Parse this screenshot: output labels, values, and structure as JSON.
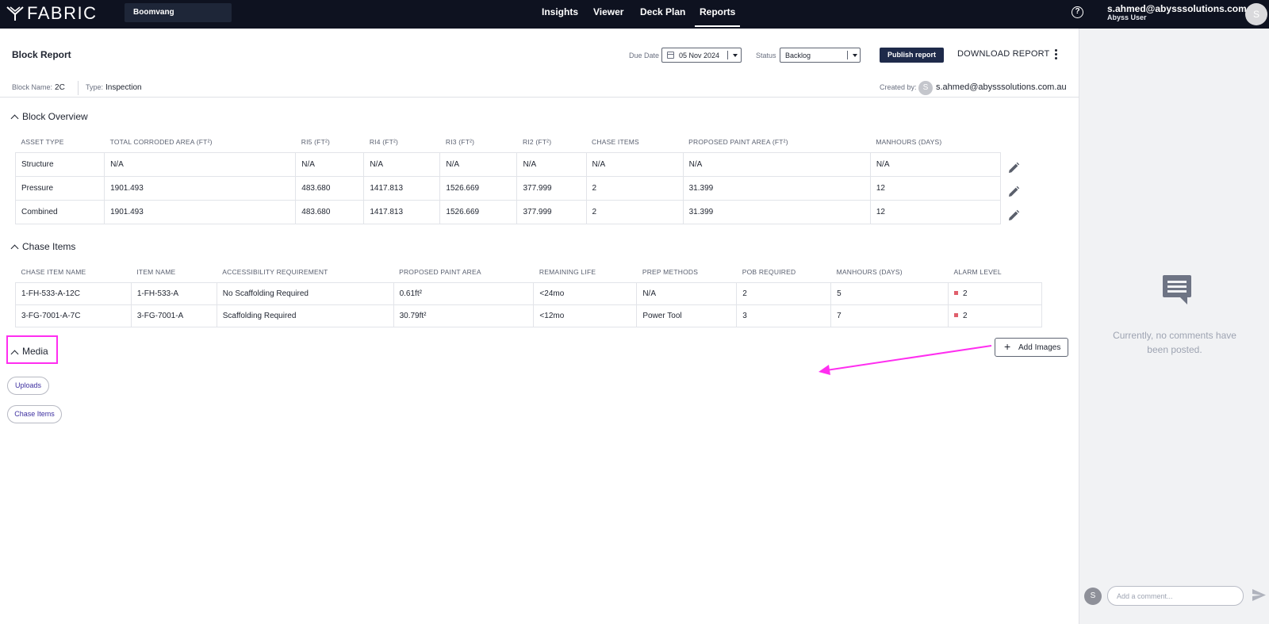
{
  "app": {
    "logo_text": "FABRIC",
    "project": "Boomvang",
    "nav": [
      "Insights",
      "Viewer",
      "Deck Plan",
      "Reports"
    ],
    "active_nav": "Reports",
    "help_glyph": "?",
    "user": {
      "email": "s.ahmed@abysssolutions.com.au",
      "role": "Abyss User",
      "initial": "S"
    }
  },
  "report": {
    "title": "Block Report",
    "due_date_label": "Due Date",
    "due_date": "05 Nov 2024",
    "status_label": "Status",
    "status": "Backlog",
    "publish_label": "Publish report",
    "download_label": "DOWNLOAD REPORT",
    "block_name_label": "Block Name:",
    "block_name": "2C",
    "type_label": "Type:",
    "type": "Inspection",
    "created_by_label": "Created by:",
    "created_by_initial": "S",
    "created_by": "s.ahmed@abysssolutions.com.au"
  },
  "block_overview": {
    "title": "Block Overview",
    "columns": [
      "ASSET TYPE",
      "TOTAL CORRODED AREA (FT²)",
      "RI5 (FT²)",
      "RI4 (FT²)",
      "RI3 (FT²)",
      "RI2 (FT²)",
      "CHASE ITEMS",
      "PROPOSED PAINT AREA (FT²)",
      "MANHOURS (DAYS)"
    ],
    "rows": [
      [
        "Structure",
        "N/A",
        "N/A",
        "N/A",
        "N/A",
        "N/A",
        "N/A",
        "N/A",
        "N/A"
      ],
      [
        "Pressure",
        "1901.493",
        "483.680",
        "1417.813",
        "1526.669",
        "377.999",
        "2",
        "31.399",
        "12"
      ],
      [
        "Combined",
        "1901.493",
        "483.680",
        "1417.813",
        "1526.669",
        "377.999",
        "2",
        "31.399",
        "12"
      ]
    ],
    "row_action_icon": "pencil-icon"
  },
  "chase_items": {
    "title": "Chase Items",
    "columns": [
      "CHASE ITEM NAME",
      "ITEM NAME",
      "ACCESSIBILITY REQUIREMENT",
      "PROPOSED PAINT AREA",
      "REMAINING LIFE",
      "PREP METHODS",
      "POB REQUIRED",
      "MANHOURS (DAYS)",
      "ALARM LEVEL"
    ],
    "rows": [
      [
        "1-FH-533-A-12C",
        "1-FH-533-A",
        "No Scaffolding Required",
        "0.61ft²",
        "<24mo",
        "N/A",
        "2",
        "5",
        "2"
      ],
      [
        "3-FG-7001-A-7C",
        "3-FG-7001-A",
        "Scaffolding Required",
        "30.79ft²",
        "<12mo",
        "Power Tool",
        "3",
        "7",
        "2"
      ]
    ],
    "alarm_color": "#e05f6c"
  },
  "media": {
    "title": "Media",
    "add_images_label": "Add Images",
    "filters": [
      "Uploads",
      "Chase Items"
    ],
    "highlight_color": "#ff2ef0"
  },
  "comments": {
    "empty_text": "Currently, no comments have been posted.",
    "input_placeholder": "Add a comment...",
    "user_initial": "S"
  }
}
